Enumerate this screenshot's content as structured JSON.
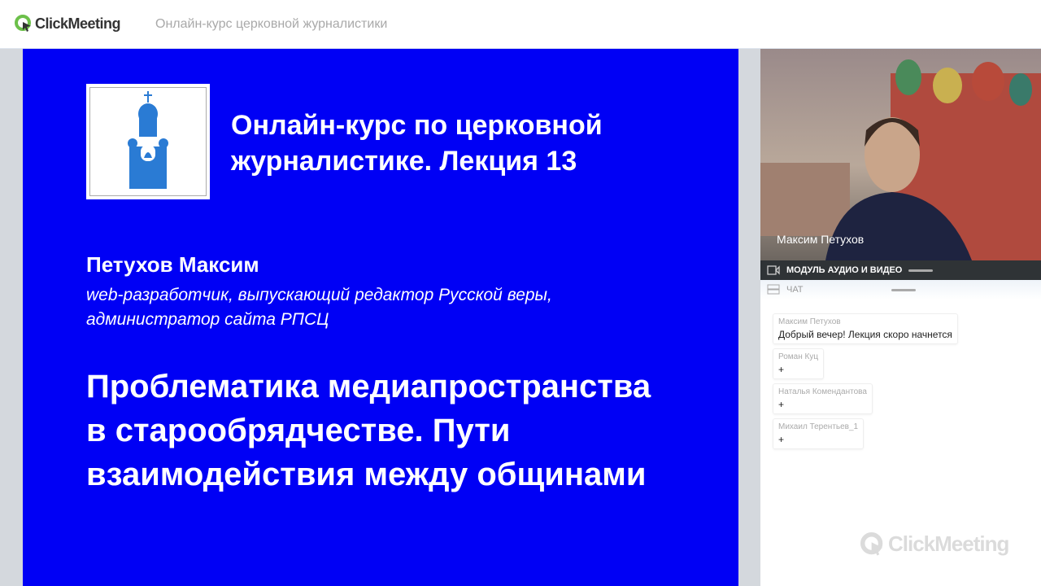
{
  "header": {
    "logo": "ClickMeeting",
    "title": "Онлайн-курс церковной журналистики"
  },
  "slide": {
    "title_line1": "Онлайн-курс по церковной",
    "title_line2": "журналистике. Лекция 13",
    "author": "Петухов Максим",
    "role_line1": "web-разработчик, выпускающий редактор Русской веры,",
    "role_line2": "администратор сайта РПСЦ",
    "topic_line1": "Проблематика медиапространства",
    "topic_line2": "в старообрядчестве. Пути",
    "topic_line3": "взаимодействия между общинами"
  },
  "video": {
    "presenter": "Максим Петухов",
    "module_label": "МОДУЛЬ АУДИО И ВИДЕО"
  },
  "chat": {
    "label": "ЧАТ",
    "messages": [
      {
        "author": "Максим Петухов",
        "text": "Добрый вечер! Лекция скоро начнется"
      },
      {
        "author": "Роман Куц",
        "text": "+"
      },
      {
        "author": "Наталья Комендантова",
        "text": "+"
      },
      {
        "author": "Михаил Терентьев_1",
        "text": "+"
      }
    ]
  },
  "watermark": "ClickMeeting",
  "colors": {
    "slide_bg": "#0000f5",
    "brand_green": "#6cc04a",
    "church": "#2a7bd4"
  }
}
